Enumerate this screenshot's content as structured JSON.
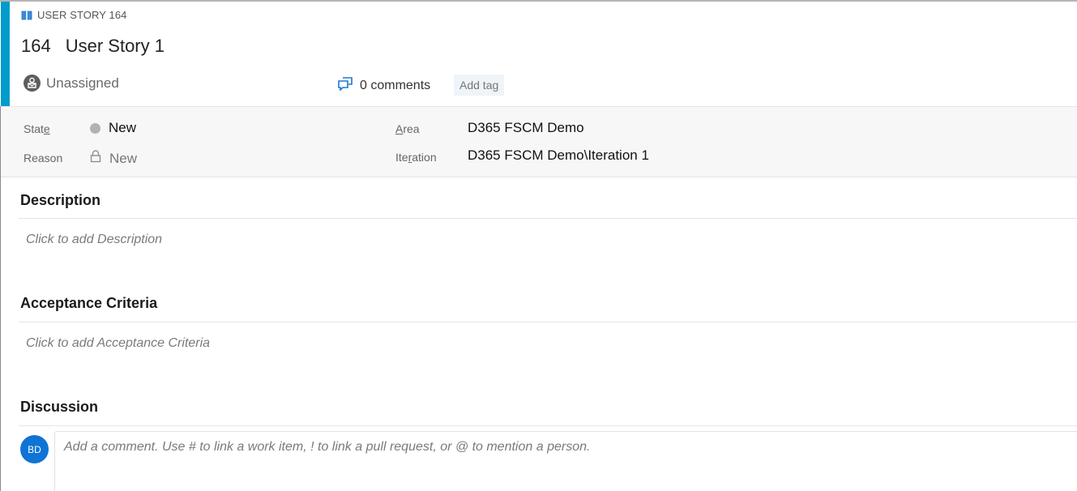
{
  "work_item": {
    "type_label": "USER STORY 164",
    "type_icon": "book-icon",
    "id": "164",
    "title": "User Story 1",
    "assigned_to": "Unassigned",
    "comments_label": "0 comments",
    "add_tag_label": "Add tag",
    "accent_color": "#009ccc"
  },
  "fields": {
    "state": {
      "label_pre": "Stat",
      "label_accel": "e",
      "value": "New",
      "dot_color": "#b2b2b2"
    },
    "reason": {
      "label": "Reason",
      "value": "New"
    },
    "area": {
      "label_accel": "A",
      "label_post": "rea",
      "value": "D365 FSCM Demo"
    },
    "iteration": {
      "label_pre": "Ite",
      "label_accel": "r",
      "label_post": "ation",
      "value": "D365 FSCM Demo\\Iteration 1"
    }
  },
  "sections": {
    "description": {
      "title": "Description",
      "placeholder": "Click to add Description"
    },
    "acceptance": {
      "title": "Acceptance Criteria",
      "placeholder": "Click to add Acceptance Criteria"
    },
    "discussion": {
      "title": "Discussion",
      "avatar_initials": "BD",
      "avatar_color": "#0e74d5",
      "comment_placeholder": "Add a comment. Use # to link a work item, ! to link a pull request, or @ to mention a person."
    }
  }
}
